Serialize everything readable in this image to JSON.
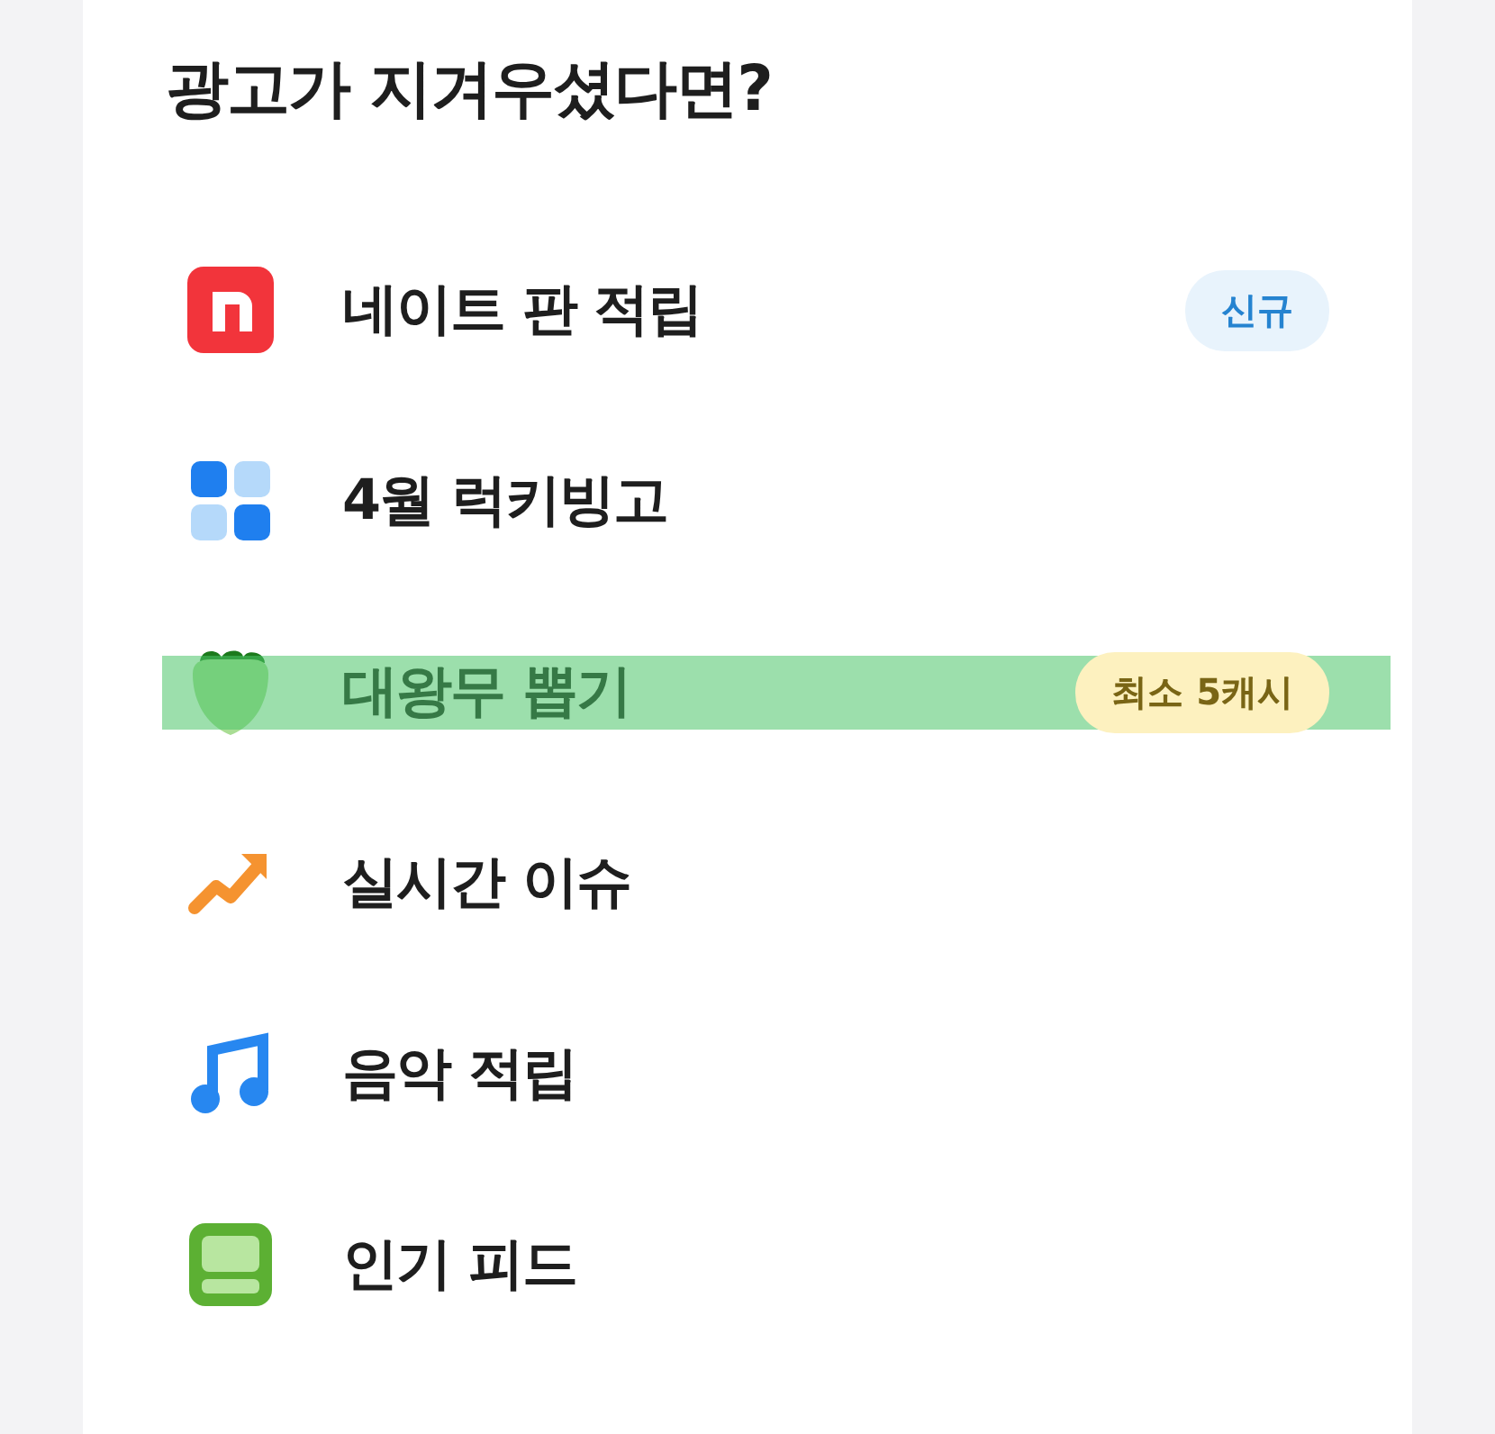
{
  "section": {
    "title": "광고가 지겨우셨다면?"
  },
  "items": [
    {
      "kind": "n-tile",
      "label": "네이트 판 적립",
      "badge": {
        "text": "신규",
        "color": "#e8f3fc"
      },
      "highlighted": false
    },
    {
      "kind": "grid",
      "label": "4월 럭키빙고",
      "highlighted": false
    },
    {
      "kind": "radish",
      "label": "대왕무 뽑기",
      "badge": {
        "text": "최소 5캐시",
        "color": "#fdf1bf"
      },
      "highlighted": true
    },
    {
      "kind": "trend",
      "label": "실시간 이슈",
      "highlighted": false
    },
    {
      "kind": "music",
      "label": "음악 적립",
      "highlighted": false
    },
    {
      "kind": "feed",
      "label": "인기 피드",
      "highlighted": false
    }
  ]
}
